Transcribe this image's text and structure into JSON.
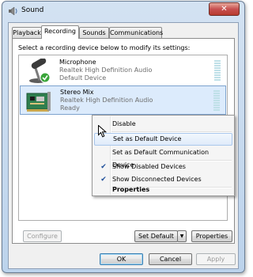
{
  "window": {
    "title": "Sound",
    "close_glyph": "✕"
  },
  "tabs": [
    {
      "label": "Playback",
      "active": false
    },
    {
      "label": "Recording",
      "active": true
    },
    {
      "label": "Sounds",
      "active": false
    },
    {
      "label": "Communications",
      "active": false
    }
  ],
  "instruction": "Select a recording device below to modify its settings:",
  "devices": [
    {
      "name": "Microphone",
      "driver": "Realtek High Definition Audio",
      "status": "Default Device",
      "icon": "microphone-icon",
      "default_check": true
    },
    {
      "name": "Stereo Mix",
      "driver": "Realtek High Definition Audio",
      "status": "Ready",
      "icon": "sound-card-icon",
      "selected": true
    }
  ],
  "context_menu": {
    "items": [
      {
        "label": "Disable"
      },
      {
        "label": "Set as Default Device",
        "highlight": true
      },
      {
        "label": "Set as Default Communication Device"
      },
      {
        "label": "Show Disabled Devices",
        "checked": true
      },
      {
        "label": "Show Disconnected Devices",
        "checked": true
      },
      {
        "label": "Properties",
        "bold": true
      }
    ],
    "check_glyph": "✔"
  },
  "buttons": {
    "configure": "Configure",
    "set_default": "Set Default",
    "dropdown_glyph": "▼",
    "properties": "Properties",
    "ok": "OK",
    "cancel": "Cancel",
    "apply": "Apply"
  },
  "colors": {
    "selection_bg": "#dcebfc",
    "selection_border": "#7da2ce",
    "menu_highlight": "#dfebfa",
    "check_green": "#3aa53a"
  }
}
